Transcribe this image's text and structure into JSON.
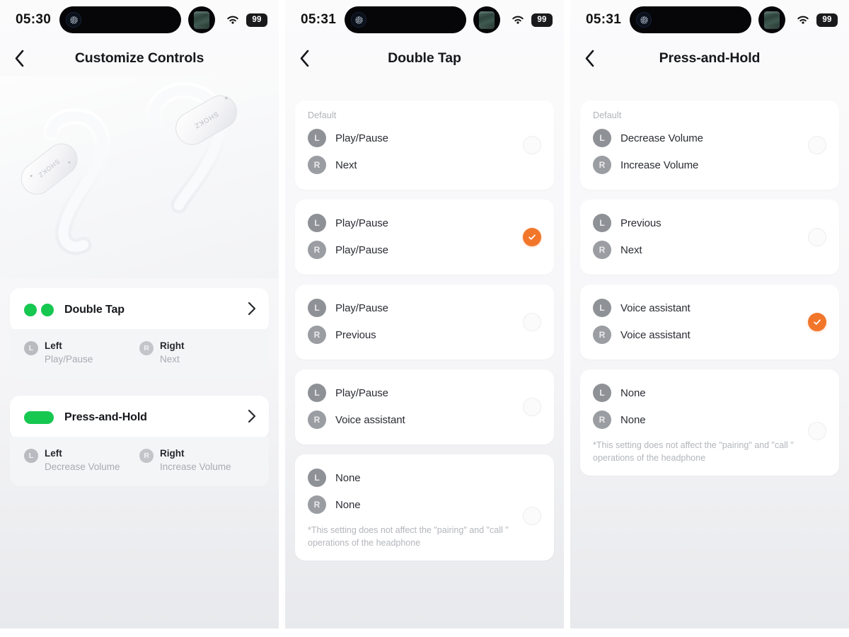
{
  "meta": {
    "green": "#16c750",
    "orange": "#f2762a",
    "card_bg": "#ffffff",
    "page_bg": "#f6f6f8"
  },
  "panels": [
    {
      "id": "customize-controls",
      "statusbar": {
        "time": "05:30",
        "wifi": "wifi-icon",
        "battery": "99"
      },
      "nav": {
        "back": "back-chevron-icon",
        "title": "Customize Controls"
      },
      "hero": {
        "alt": "open-ear-headphones-product-image"
      },
      "settings": [
        {
          "label": "Double Tap",
          "indicator": "two-dots",
          "chevron": "chevron-right-icon",
          "left": {
            "badge": "L",
            "title": "Left",
            "value": "Play/Pause"
          },
          "right": {
            "badge": "R",
            "title": "Right",
            "value": "Next"
          }
        },
        {
          "label": "Press-and-Hold",
          "indicator": "pill",
          "chevron": "chevron-right-icon",
          "left": {
            "badge": "L",
            "title": "Left",
            "value": "Decrease Volume"
          },
          "right": {
            "badge": "R",
            "title": "Right",
            "value": "Increase Volume"
          }
        }
      ]
    },
    {
      "id": "double-tap",
      "statusbar": {
        "time": "05:31",
        "wifi": "wifi-icon",
        "battery": "99"
      },
      "nav": {
        "back": "back-chevron-icon",
        "title": "Double Tap"
      },
      "default_label": "Default",
      "note": "*This setting does not affect the \"pairing\" and \"call \" operations of the headphone",
      "options": [
        {
          "default": true,
          "selected": false,
          "left": "Play/Pause",
          "right": "Next",
          "note": false
        },
        {
          "default": false,
          "selected": true,
          "left": "Play/Pause",
          "right": "Play/Pause",
          "note": false
        },
        {
          "default": false,
          "selected": false,
          "left": "Play/Pause",
          "right": "Previous",
          "note": false
        },
        {
          "default": false,
          "selected": false,
          "left": "Play/Pause",
          "right": "Voice assistant",
          "note": false
        },
        {
          "default": false,
          "selected": false,
          "left": "None",
          "right": "None",
          "note": true
        }
      ]
    },
    {
      "id": "press-and-hold",
      "statusbar": {
        "time": "05:31",
        "wifi": "wifi-icon",
        "battery": "99"
      },
      "nav": {
        "back": "back-chevron-icon",
        "title": "Press-and-Hold"
      },
      "default_label": "Default",
      "note": "*This setting does not affect the \"pairing\" and \"call \" operations of the headphone",
      "options": [
        {
          "default": true,
          "selected": false,
          "left": "Decrease Volume",
          "right": "Increase Volume",
          "note": false
        },
        {
          "default": false,
          "selected": false,
          "left": "Previous",
          "right": "Next",
          "note": false
        },
        {
          "default": false,
          "selected": true,
          "left": "Voice assistant",
          "right": "Voice assistant",
          "note": false
        },
        {
          "default": false,
          "selected": false,
          "left": "None",
          "right": "None",
          "note": true
        }
      ]
    }
  ]
}
